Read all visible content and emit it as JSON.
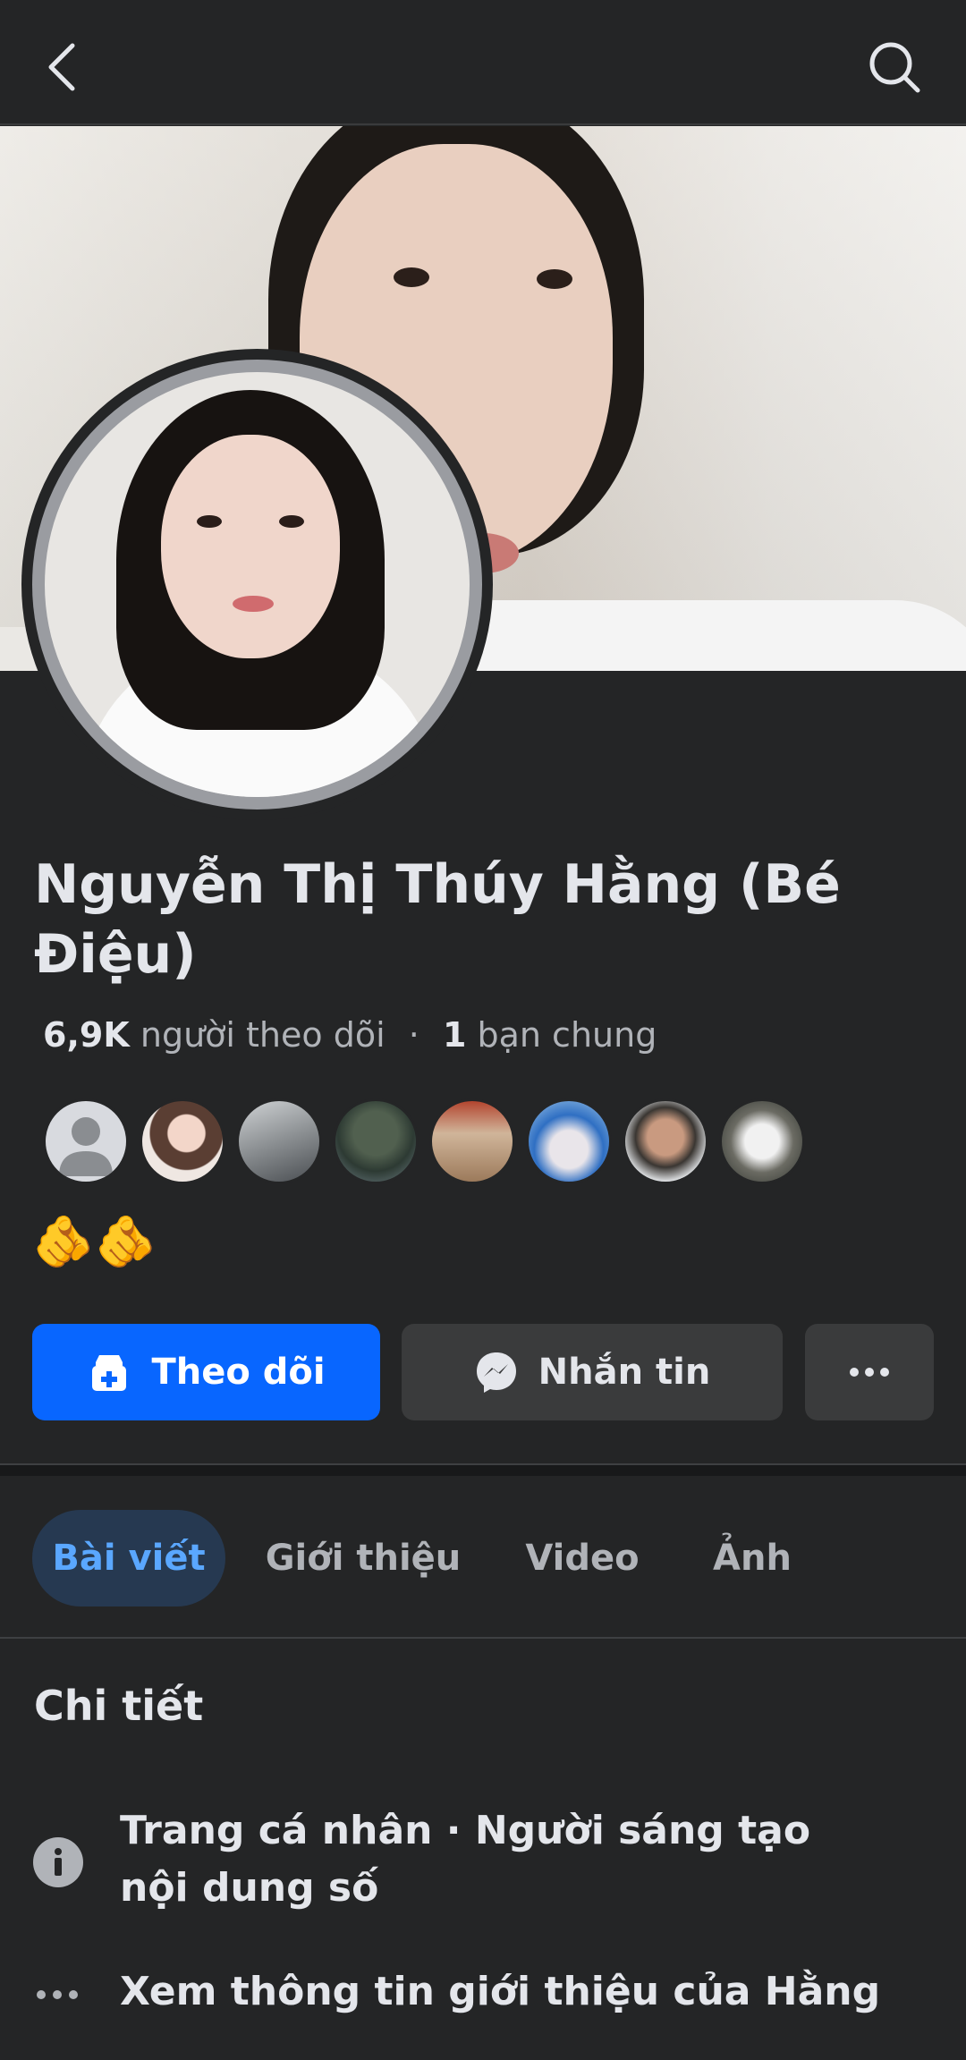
{
  "header": {
    "back_icon": "back-arrow-icon",
    "search_icon": "search-icon"
  },
  "profile": {
    "name": "Nguyễn Thị Thúy Hằng (Bé Điệu)",
    "followers_count": "6,9K",
    "followers_label": "người theo dõi",
    "separator": "·",
    "mutual_count": "1",
    "mutual_label": "bạn chung",
    "bio_emoji": "🫵🫵"
  },
  "actions": {
    "follow_label": "Theo dõi",
    "message_label": "Nhắn tin",
    "more_label": "···"
  },
  "tabs": [
    {
      "label": "Bài viết",
      "active": true
    },
    {
      "label": "Giới thiệu",
      "active": false
    },
    {
      "label": "Video",
      "active": false
    },
    {
      "label": "Ảnh",
      "active": false
    }
  ],
  "details": {
    "title": "Chi tiết",
    "items": [
      {
        "icon": "info-icon",
        "text": "Trang cá nhân · Người sáng tạo nội dung số"
      },
      {
        "icon": "more-dots-icon",
        "text": "Xem thông tin giới thiệu của Hằng"
      }
    ]
  },
  "colors": {
    "background": "#242526",
    "primary": "#0866ff",
    "active_tab_bg": "#263951",
    "active_tab_text": "#5aa7ff",
    "secondary_button": "#3a3b3c"
  }
}
